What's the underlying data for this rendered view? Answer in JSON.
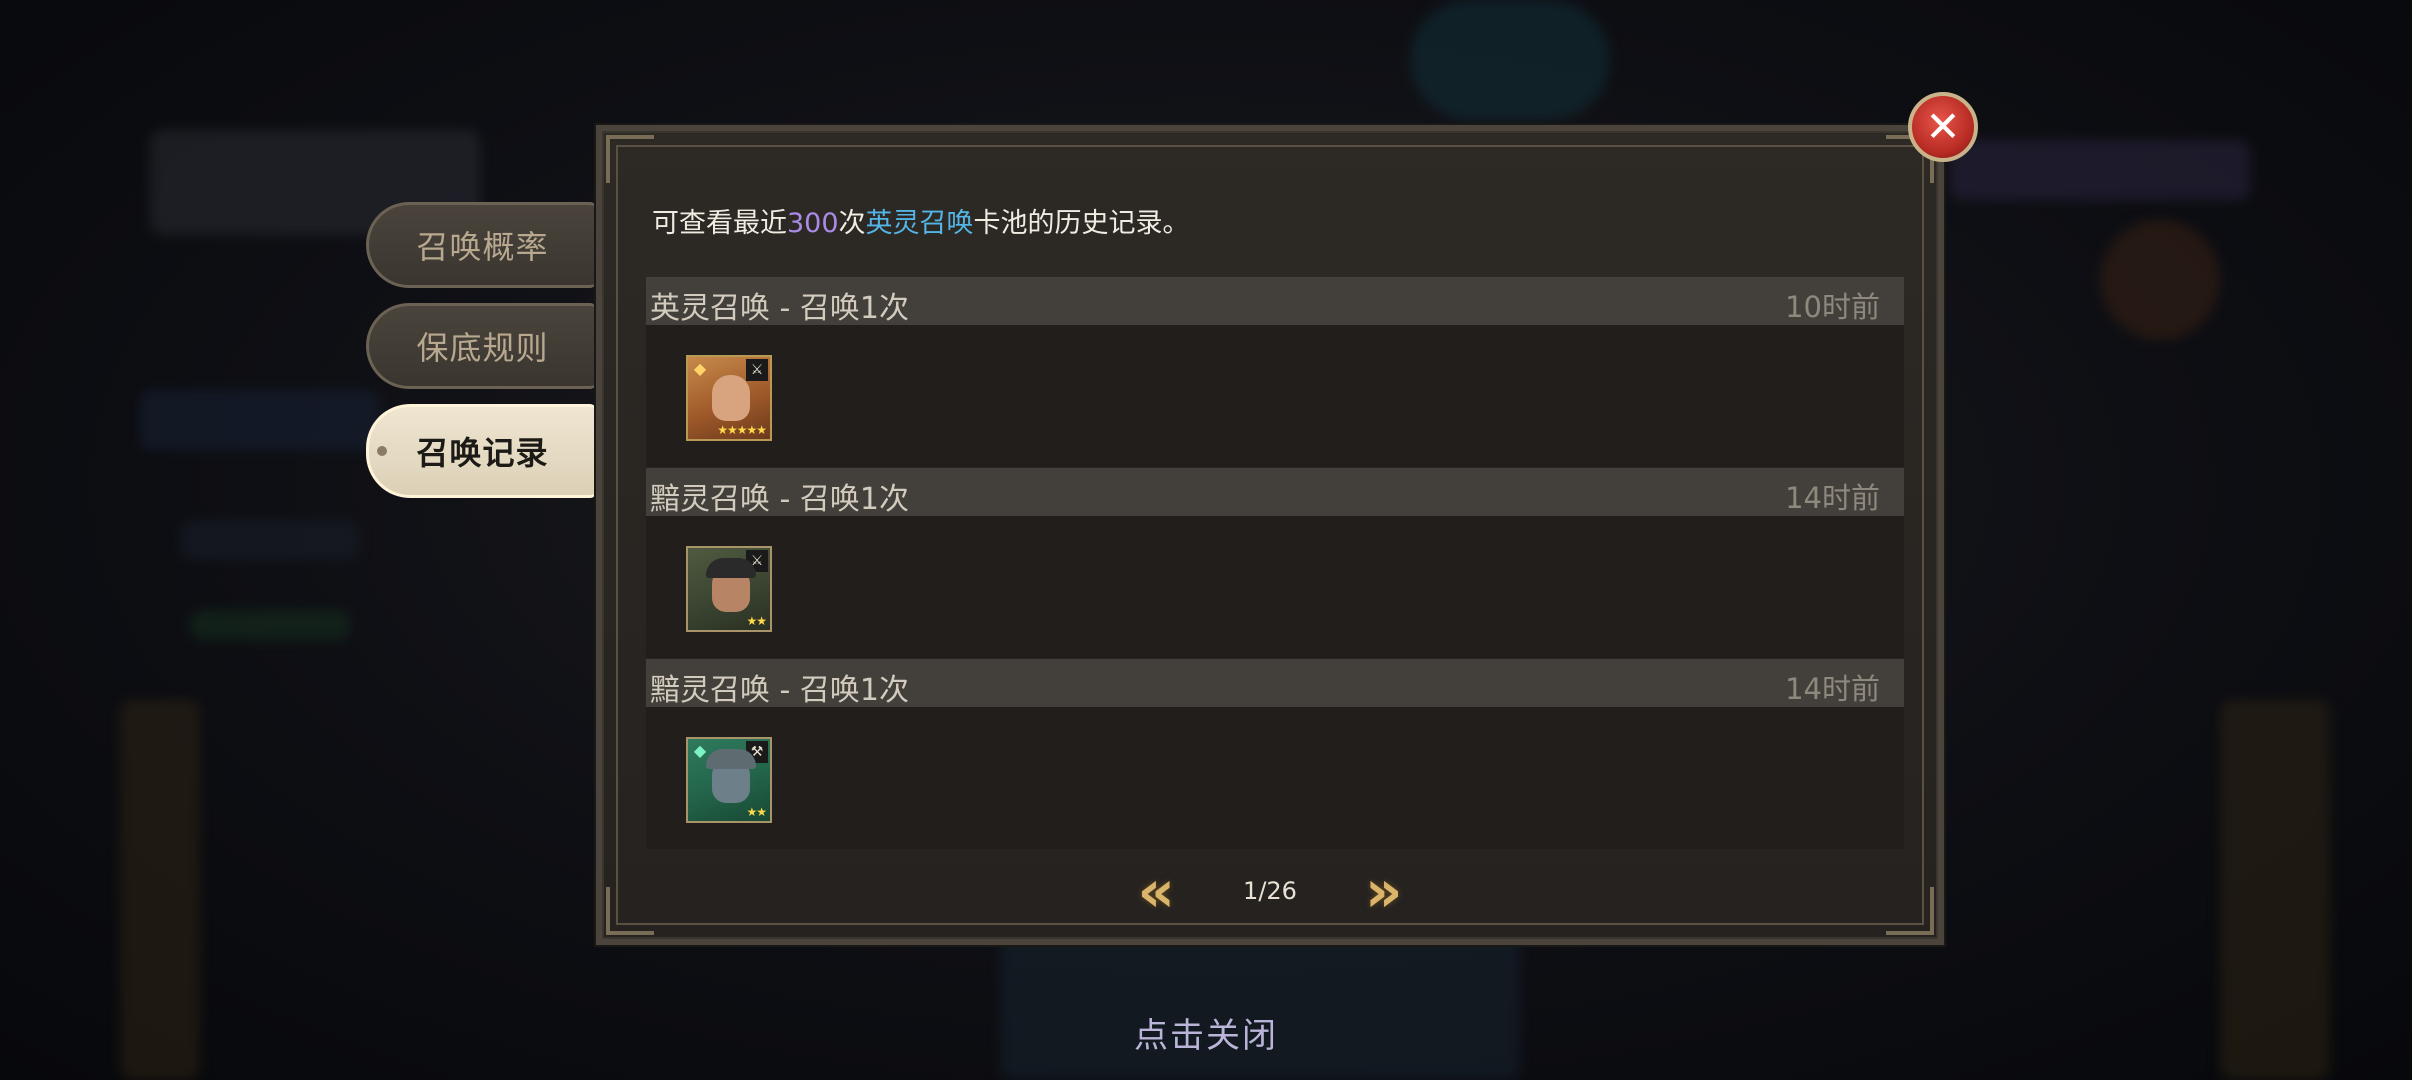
{
  "tabs": [
    {
      "label": "召唤概率"
    },
    {
      "label": "保底规则"
    },
    {
      "label": "召唤记录"
    }
  ],
  "intro": {
    "prefix": "可查看最近",
    "count": "300",
    "mid": "次",
    "pool": "英灵召唤",
    "suffix": "卡池的历史记录。"
  },
  "records": [
    {
      "title": "英灵召唤 - 召唤1次",
      "time": "10时前",
      "hero_stars": 5,
      "stars_text": "★★★★★"
    },
    {
      "title": "黯灵召唤 - 召唤1次",
      "time": "14时前",
      "hero_stars": 2,
      "stars_text": "★★"
    },
    {
      "title": "黯灵召唤 - 召唤1次",
      "time": "14时前",
      "hero_stars": 2,
      "stars_text": "★★"
    }
  ],
  "pagination": {
    "current": "1/26"
  },
  "footer": {
    "tap_close": "点击关闭"
  },
  "colors": {
    "count_highlight": "#a98be6",
    "pool_highlight": "#53b4e6",
    "close_red": "#c0392b"
  }
}
